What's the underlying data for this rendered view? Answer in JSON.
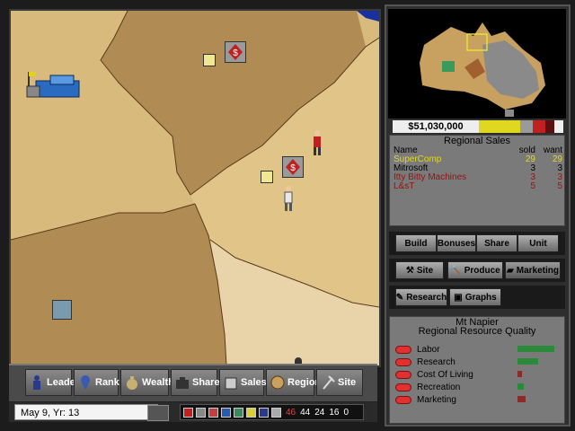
{
  "toolbar": {
    "leader": "Leader",
    "rank": "Rank",
    "wealth": "Wealth",
    "share": "Share",
    "sales": "Sales",
    "region": "Region",
    "site": "Site"
  },
  "status": {
    "date": "May 9, Yr: 13",
    "counters": [
      "46",
      "44",
      "24",
      "16",
      "0"
    ]
  },
  "finance": {
    "money": "$51,030,000"
  },
  "regional_sales": {
    "title": "Regional Sales",
    "col_name": "Name",
    "col_sold": "sold",
    "col_want": "want",
    "rows": [
      {
        "name": "SuperComp",
        "sold": "29",
        "want": "29",
        "color": "#e0d820"
      },
      {
        "name": "Mitrosoft",
        "sold": "3",
        "want": "3",
        "color": "#000000"
      },
      {
        "name": "Itty Bitty Machines",
        "sold": "3",
        "want": "3",
        "color": "#9a1010"
      },
      {
        "name": "L&sT",
        "sold": "5",
        "want": "5",
        "color": "#9a1010"
      }
    ]
  },
  "panel_buttons": {
    "build": "Build",
    "bonuses": "Bonuses",
    "share": "Share",
    "unit": "Unit",
    "site": "Site",
    "produce": "Produce",
    "marketing": "Marketing",
    "research": "Research",
    "graphs": "Graphs"
  },
  "region_info": {
    "name": "Mt Napier",
    "subtitle": "Regional Resource Quality",
    "resources": [
      {
        "label": "Labor",
        "level": 0.9,
        "color": "#2a8a3a"
      },
      {
        "label": "Research",
        "level": 0.5,
        "color": "#2a8a3a"
      },
      {
        "label": "Cost Of Living",
        "level": 0.1,
        "color": "#8a2a2a"
      },
      {
        "label": "Recreation",
        "level": 0.15,
        "color": "#2a8a3a"
      },
      {
        "label": "Marketing",
        "level": 0.2,
        "color": "#8a2a2a"
      }
    ]
  }
}
